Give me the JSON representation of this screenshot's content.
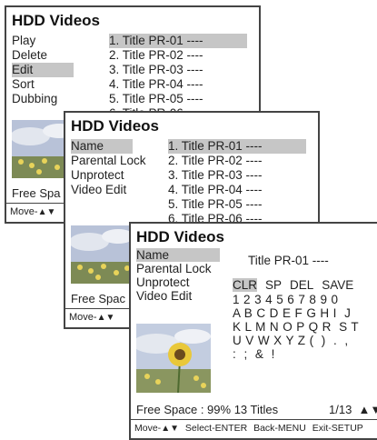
{
  "app_title": "HDD Videos",
  "menu1": {
    "items": [
      "Play",
      "Delete",
      "Edit",
      "Sort",
      "Dubbing"
    ],
    "selected": 2
  },
  "menu2": {
    "items": [
      "Name",
      "Parental Lock",
      "Unprotect",
      "Video Edit"
    ],
    "selected": 0
  },
  "menu3": {
    "items": [
      "Name",
      "Parental Lock",
      "Unprotect",
      "Video Edit"
    ],
    "selected": 0
  },
  "titles": [
    "1. Title PR-01 ----",
    "2. Title PR-02 ----",
    "3. Title PR-03 ----",
    "4. Title PR-04 ----",
    "5. Title PR-05 ----",
    "6. Title PR-06 ----"
  ],
  "free_space_short": "Free Spa",
  "free_space_mid": "Free Spac",
  "footer_short": "Move-",
  "name_edit": {
    "current_name": "Title PR-01 ----",
    "commands": [
      "CLR",
      "SP",
      "DEL",
      "SAVE"
    ],
    "selected_command": 0,
    "char_rows": [
      "1 2 3 4 5 6 7 8 9 0",
      "A B C D E F G H I  J",
      "K L M N O P Q R  S T",
      "U V W X Y Z (  )  .  ,",
      ":  ;  &  !"
    ]
  },
  "status": {
    "free_space": "Free Space : 99%",
    "titles_count": "13 Titles",
    "page": "1/13"
  },
  "footer": {
    "move": "Move-",
    "select": "Select-ENTER",
    "back": "Back-MENU",
    "exit": "Exit-SETUP"
  }
}
